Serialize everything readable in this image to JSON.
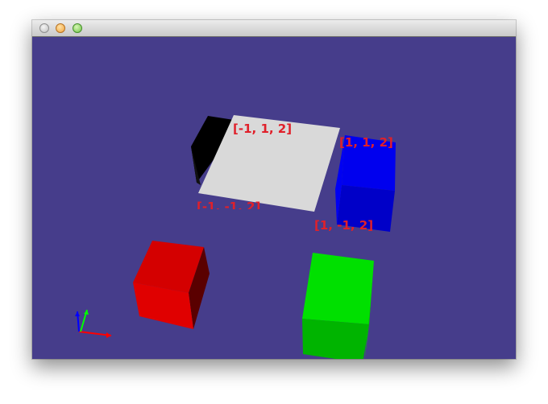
{
  "window": {
    "buttons": [
      {
        "name": "close",
        "color": "#d0d0d0"
      },
      {
        "name": "minimize",
        "color": "#f2a33a"
      },
      {
        "name": "zoom",
        "color": "#6dc142"
      }
    ]
  },
  "scene": {
    "background_color": "#463d8b",
    "corner_labels": {
      "top_left": "[-1, 1, 2]",
      "top_right": "[1, 1, 2]",
      "bottom_left": "[-1, -1, 2]",
      "bottom_right": "[1, -1, 2]"
    },
    "objects": [
      {
        "name": "white plane",
        "color": "#d8d8d8"
      },
      {
        "name": "black cube",
        "color": "#000000"
      },
      {
        "name": "blue cube",
        "color": "#0000ff"
      },
      {
        "name": "red cube",
        "color": "#e00000"
      },
      {
        "name": "green cube",
        "color": "#00dd00"
      }
    ],
    "axes": [
      {
        "name": "x-axis",
        "color": "#ff0000"
      },
      {
        "name": "y-axis",
        "color": "#00ff00"
      },
      {
        "name": "z-axis",
        "color": "#0000ff"
      }
    ]
  }
}
